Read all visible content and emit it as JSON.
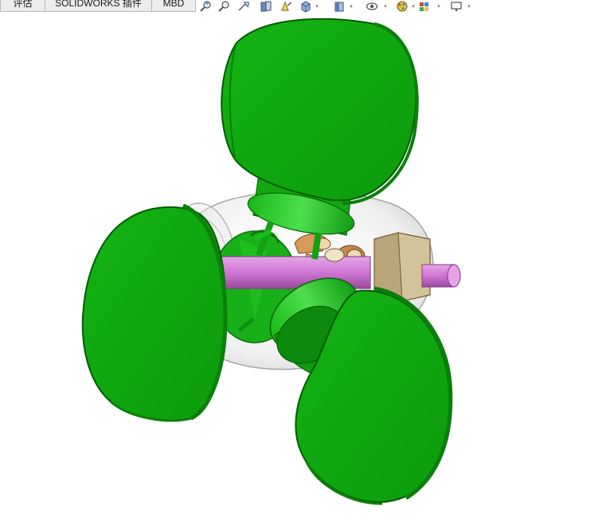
{
  "command_manager": {
    "tabs": [
      {
        "id": "evaluate",
        "label": "评估"
      },
      {
        "id": "addins",
        "label": "SOLIDWORKS 插件"
      },
      {
        "id": "mbd",
        "label": "MBD"
      }
    ]
  },
  "heads_up_toolbar": {
    "buttons": [
      {
        "icon": "zoom-to-fit-icon"
      },
      {
        "icon": "zoom-to-area-icon"
      },
      {
        "icon": "previous-view-icon"
      },
      {
        "icon": "section-view-icon"
      },
      {
        "icon": "dynamic-annotation-views-icon"
      },
      {
        "icon": "view-orientation-icon"
      },
      {
        "icon": "display-style-icon"
      },
      {
        "icon": "hide-show-items-icon"
      },
      {
        "icon": "edit-appearance-icon"
      },
      {
        "icon": "apply-scene-icon"
      },
      {
        "icon": "view-settings-icon"
      }
    ],
    "dropdown_glyph": "▾"
  },
  "model": {
    "colors": {
      "blade": "#0fae0f",
      "blade_dark": "#097a09",
      "hub_ring": "#1cc61c",
      "shaft": "#cf76d4",
      "shaft_dark": "#9a4a9e",
      "block": "#d2c39a",
      "gear": "#c98a4b",
      "housing": "#d6d6d6",
      "background": "#ffffff"
    }
  }
}
